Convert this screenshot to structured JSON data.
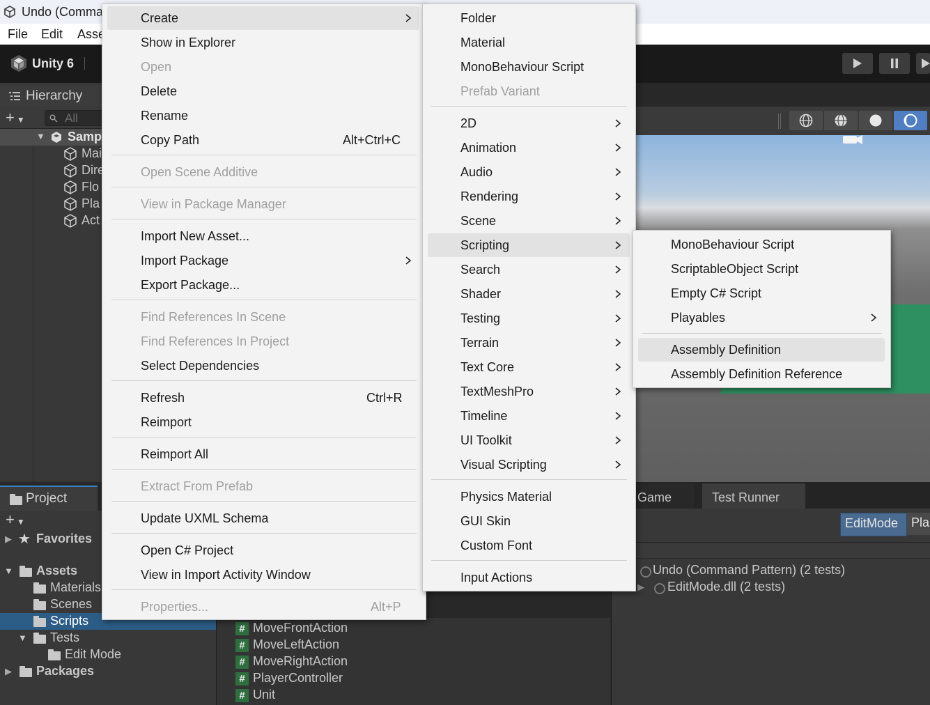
{
  "window": {
    "title": "Undo (Comma",
    "menu": [
      "File",
      "Edit",
      "Asse"
    ]
  },
  "toolbar": {
    "brand": "Unity 6"
  },
  "hierarchy": {
    "tab_label": "Hierarchy",
    "search_placeholder": "All",
    "scene_name": "Samp",
    "items": [
      "Mai",
      "Dire",
      "Flo",
      "Pla",
      "Act"
    ]
  },
  "project": {
    "tab_label": "Project",
    "favorites": "Favorites",
    "assets": "Assets",
    "materials": "Materials",
    "scenes": "Scenes",
    "scripts": "Scripts",
    "tests": "Tests",
    "edit_mode": "Edit Mode",
    "packages": "Packages",
    "files": [
      "MoveFrontAction",
      "MoveLeftAction",
      "MoveRightAction",
      "PlayerController",
      "Unit"
    ]
  },
  "test_runner": {
    "tabs": [
      "Game",
      "Test Runner"
    ],
    "modes": [
      "EditMode",
      "Pla"
    ],
    "rows": [
      "Undo (Command Pattern) (2 tests)",
      "EditMode.dll (2 tests)"
    ]
  },
  "context_menu": {
    "create": "Create",
    "show_in_explorer": "Show in Explorer",
    "open": "Open",
    "delete": "Delete",
    "rename": "Rename",
    "copy_path": "Copy Path",
    "copy_path_shortcut": "Alt+Ctrl+C",
    "open_scene_additive": "Open Scene Additive",
    "view_in_package_manager": "View in Package Manager",
    "import_new_asset": "Import New Asset...",
    "import_package": "Import Package",
    "export_package": "Export Package...",
    "find_refs_scene": "Find References In Scene",
    "find_refs_project": "Find References In Project",
    "select_dependencies": "Select Dependencies",
    "refresh": "Refresh",
    "refresh_shortcut": "Ctrl+R",
    "reimport": "Reimport",
    "reimport_all": "Reimport All",
    "extract_from_prefab": "Extract From Prefab",
    "update_uxml_schema": "Update UXML Schema",
    "open_csharp_project": "Open C# Project",
    "view_import_activity": "View in Import Activity Window",
    "properties": "Properties...",
    "properties_shortcut": "Alt+P"
  },
  "create_menu": {
    "folder": "Folder",
    "material": "Material",
    "monobehaviour_script": "MonoBehaviour Script",
    "prefab_variant": "Prefab Variant",
    "two_d": "2D",
    "animation": "Animation",
    "audio": "Audio",
    "rendering": "Rendering",
    "scene": "Scene",
    "scripting": "Scripting",
    "search": "Search",
    "shader": "Shader",
    "testing": "Testing",
    "terrain": "Terrain",
    "text_core": "Text Core",
    "textmeshpro": "TextMeshPro",
    "timeline": "Timeline",
    "ui_toolkit": "UI Toolkit",
    "visual_scripting": "Visual Scripting",
    "physics_material": "Physics Material",
    "gui_skin": "GUI Skin",
    "custom_font": "Custom Font",
    "input_actions": "Input Actions"
  },
  "scripting_menu": {
    "monobehaviour_script": "MonoBehaviour Script",
    "scriptableobject_script": "ScriptableObject Script",
    "empty_csharp_script": "Empty C# Script",
    "playables": "Playables",
    "assembly_definition": "Assembly Definition",
    "assembly_definition_reference": "Assembly Definition Reference"
  }
}
